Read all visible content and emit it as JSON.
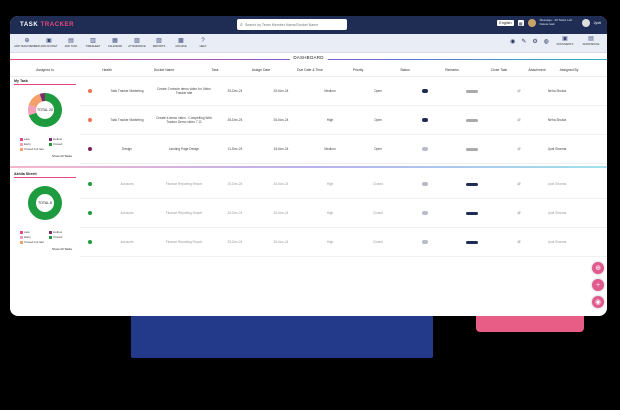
{
  "app": {
    "title_part1": "TASK ",
    "title_part2": "TRACKER"
  },
  "search": {
    "placeholder": "Search by Team Member Name/Docket Name"
  },
  "topbar": {
    "language": "English",
    "message_line1": "Message - 20 Tasks Left",
    "message_line2": "Delete task",
    "user": "Jyoti"
  },
  "toolbar": {
    "items": [
      {
        "label": "ADD TEAM MEMBER",
        "icon": "user-plus-icon"
      },
      {
        "label": "ADD DOCKET",
        "icon": "folder-icon"
      },
      {
        "label": "ADD TASK",
        "icon": "clipboard-icon"
      },
      {
        "label": "TIMESHEET",
        "icon": "sheet-icon"
      },
      {
        "label": "CALENDAR",
        "icon": "calendar-icon"
      },
      {
        "label": "ATTENDANCE",
        "icon": "attendance-icon"
      },
      {
        "label": "REPORTS",
        "icon": "chart-icon"
      },
      {
        "label": "ARCHIVE",
        "icon": "archive-icon"
      },
      {
        "label": "HELP",
        "icon": "help-icon"
      }
    ],
    "right_items": [
      {
        "label": "DOCUMENTS",
        "icon": "documents-icon"
      },
      {
        "label": "WORKSPACE",
        "icon": "briefcase-icon"
      }
    ]
  },
  "dashboard_title": "DASHBOARD",
  "columns": [
    "Assigned to",
    "Health",
    "Docket Name",
    "Task",
    "Assign Date",
    "Due Date & Time",
    "Priority",
    "Status",
    "Remarks",
    "Close Task",
    "Attachment",
    "Assigned By"
  ],
  "sections": [
    {
      "who": "My Task",
      "donut_label": "TOTAL 20",
      "donut_value": "20",
      "legend": [
        {
          "label": "Late",
          "color": "#e84a7f"
        },
        {
          "label": "Hollow",
          "color": "#7a2e6b"
        },
        {
          "label": "Early",
          "color": "#f4a0b8"
        },
        {
          "label": "Closed",
          "color": "#1e9b3f"
        },
        {
          "label": "Closed but late",
          "color": "#f4a06a"
        }
      ],
      "show_all": "Show All Tasks",
      "rows": [
        {
          "health": "#f07058",
          "docket": "Task Tracker Marketing",
          "task": "Create 2 minute demo video for Video Tracker site",
          "assign": "25-Dec-24",
          "due": "25-Nov-24",
          "priority": "Medium",
          "status": "Open",
          "remark": "dark",
          "close": "grey",
          "by": "Neha Shukla",
          "faded": false
        },
        {
          "health": "#f07058",
          "docket": "Task Tracker Marketing",
          "task": "Create a demo video - Compelling Web Tracker Demo video 7 11",
          "assign": "26-Dec-24",
          "due": "26-Nov-24",
          "priority": "High",
          "status": "Open",
          "remark": "dark",
          "close": "grey",
          "by": "Neha Shukla",
          "faded": false
        },
        {
          "health": "#7a1e5a",
          "docket": "Design",
          "task": "Landing Page Design",
          "assign": "11-Dec-24",
          "due": "15-Nov-24",
          "priority": "Medium",
          "status": "Open",
          "remark": "grey",
          "close": "grey",
          "by": "Jyoti Sharma",
          "faded": false
        }
      ]
    },
    {
      "who": "Akhila Sheetl",
      "donut_label": "TOTAL 8",
      "donut_value": "8",
      "legend": [
        {
          "label": "Late",
          "color": "#e84a7f"
        },
        {
          "label": "Hollow",
          "color": "#7a2e6b"
        },
        {
          "label": "Early",
          "color": "#f4a0b8"
        },
        {
          "label": "Closed",
          "color": "#1e9b3f"
        },
        {
          "label": "Closed but late",
          "color": "#f4a06a"
        }
      ],
      "show_all": "Show All Tasks",
      "rows": [
        {
          "health": "#1e9b3f",
          "docket": "Accounts",
          "task": "Finance Reporting Report",
          "assign": "25-Dec-24",
          "due": "26-Nov-24",
          "priority": "High",
          "status": "Closed",
          "remark": "grey",
          "close": "dark",
          "by": "Jyoti Sharma",
          "faded": true
        },
        {
          "health": "#1e9b3f",
          "docket": "Accounts",
          "task": "Finance Reporting Report",
          "assign": "25-Dec-24",
          "due": "26-Nov-24",
          "priority": "High",
          "status": "Closed",
          "remark": "grey",
          "close": "dark",
          "by": "Jyoti Sharma",
          "faded": true
        },
        {
          "health": "#1e9b3f",
          "docket": "Accounts",
          "task": "Finance Reporting Report",
          "assign": "25-Dec-24",
          "due": "26-Nov-24",
          "priority": "High",
          "status": "Closed",
          "remark": "grey",
          "close": "dark",
          "by": "Jyoti Sharma",
          "faded": true
        }
      ]
    }
  ],
  "donut_shares": [
    {
      "sectors": [
        {
          "color": "#1e9b3f",
          "value": 70
        },
        {
          "color": "#f4a0b8",
          "value": 10
        },
        {
          "color": "#f4a06a",
          "value": 15
        },
        {
          "color": "#7a2e6b",
          "value": 5
        }
      ]
    },
    {
      "sectors": [
        {
          "color": "#1e9b3f",
          "value": 100
        }
      ]
    }
  ],
  "fabs": [
    {
      "icon": "user-add-icon",
      "glyph": "⊕"
    },
    {
      "icon": "plus-icon",
      "glyph": "+"
    },
    {
      "icon": "chat-icon",
      "glyph": "◉"
    }
  ]
}
